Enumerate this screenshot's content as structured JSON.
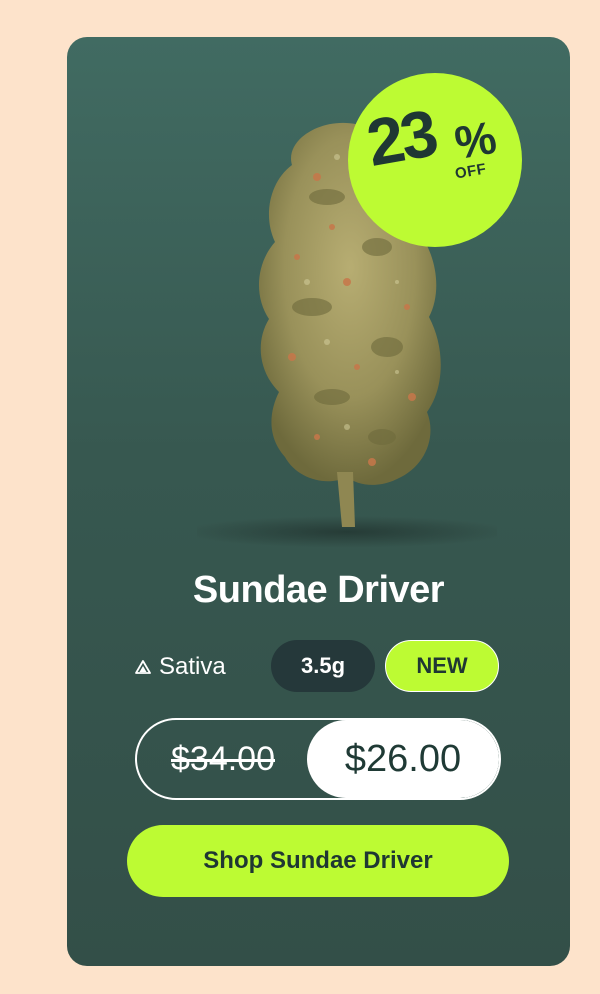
{
  "product": {
    "name": "Sundae Driver",
    "type": "Sativa",
    "weight": "3.5g",
    "tag": "NEW",
    "image_icon": "cannabis-bud-image"
  },
  "discount": {
    "value": "23",
    "percent_sign": "%",
    "off_label": "OFF"
  },
  "pricing": {
    "original_price": "$34.00",
    "sale_price": "$26.00"
  },
  "cta": {
    "label": "Shop Sundae Driver"
  },
  "colors": {
    "page_background": "#fde3cb",
    "card_background": "#3a5d55",
    "accent_lime": "#bdfb33",
    "dark_text": "#1f3733",
    "weight_pill": "#25383a"
  }
}
